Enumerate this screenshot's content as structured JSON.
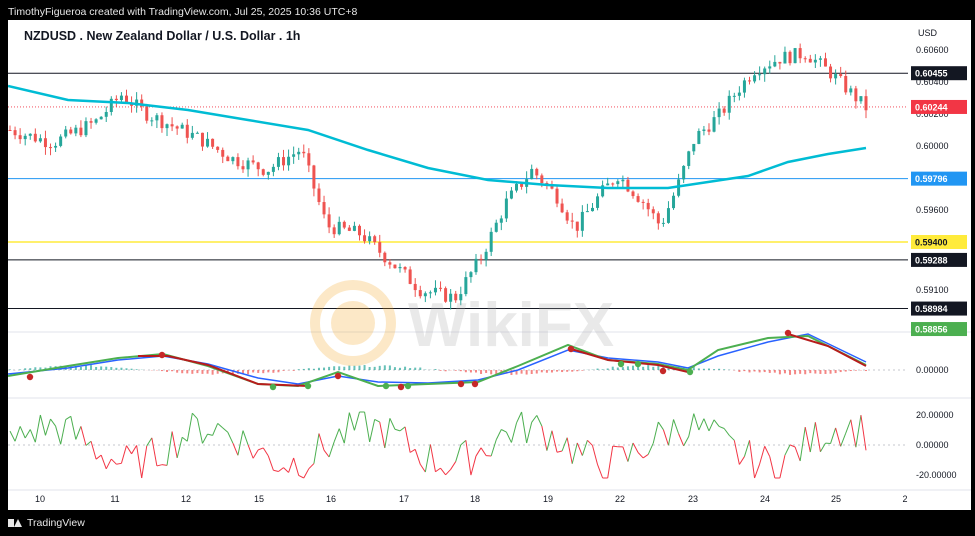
{
  "header": {
    "attribution": "TimothyFigueroa created with TradingView.com, Jul 25, 2025 10:36 UTC+8"
  },
  "chart": {
    "symbol_title": "NZDUSD . New Zealand Dollar / U.S. Dollar . 1h",
    "currency": "USD",
    "price_axis_labels": [
      "0.60600",
      "0.60400",
      "0.60200",
      "0.60000",
      "0.59600",
      "0.59100"
    ],
    "price_tags": [
      {
        "label": "0.60455",
        "bg": "#131722",
        "fg": "#ffffff"
      },
      {
        "label": "0.60244",
        "bg": "#f23645",
        "fg": "#ffffff"
      },
      {
        "label": "0.59796",
        "bg": "#2196f3",
        "fg": "#ffffff"
      },
      {
        "label": "0.59400",
        "bg": "#ffeb3b",
        "fg": "#131722"
      },
      {
        "label": "0.59288",
        "bg": "#131722",
        "fg": "#ffffff"
      },
      {
        "label": "0.58984",
        "bg": "#131722",
        "fg": "#ffffff"
      },
      {
        "label": "0.58856",
        "bg": "#4caf50",
        "fg": "#ffffff"
      }
    ],
    "macd_axis_label": "0.00000",
    "osc_axis_labels": [
      "20.00000",
      "0.00000",
      "-20.00000"
    ],
    "time_labels": [
      "10",
      "11",
      "12",
      "15",
      "16",
      "17",
      "18",
      "19",
      "22",
      "23",
      "24",
      "25",
      "2"
    ],
    "colors": {
      "up": "#26a69a",
      "down": "#ef5350",
      "ma_line": "#00bcd4",
      "macd_line": "#4caf50",
      "signal_line": "#2962ff",
      "osc_up": "#4caf50",
      "osc_down": "#f23645"
    },
    "watermark": "WikiFX"
  },
  "footer": {
    "brand": "TradingView"
  }
}
